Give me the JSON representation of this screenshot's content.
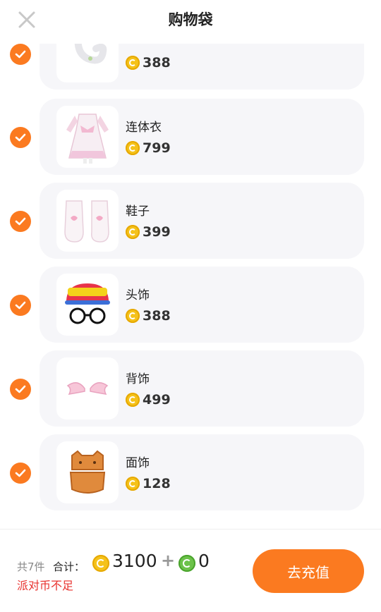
{
  "header": {
    "title": "购物袋"
  },
  "items": [
    {
      "name": "",
      "price": "388",
      "icon": "tail-icon"
    },
    {
      "name": "连体衣",
      "price": "799",
      "icon": "dress-icon"
    },
    {
      "name": "鞋子",
      "price": "399",
      "icon": "shoes-icon"
    },
    {
      "name": "头饰",
      "price": "388",
      "icon": "hat-glasses-icon"
    },
    {
      "name": "背饰",
      "price": "499",
      "icon": "wings-icon"
    },
    {
      "name": "面饰",
      "price": "128",
      "icon": "cookie-mask-icon"
    }
  ],
  "footer": {
    "count_text": "共7件",
    "total_label": "合计：",
    "total_amount": "3100",
    "plus": "+",
    "green_amount": "0",
    "warning": "派对币不足",
    "recharge_label": "去充值"
  },
  "colors": {
    "accent": "#fb7a20",
    "warning": "#e8312d",
    "coin": "#f5c21a",
    "green_coin": "#6cc24a"
  }
}
